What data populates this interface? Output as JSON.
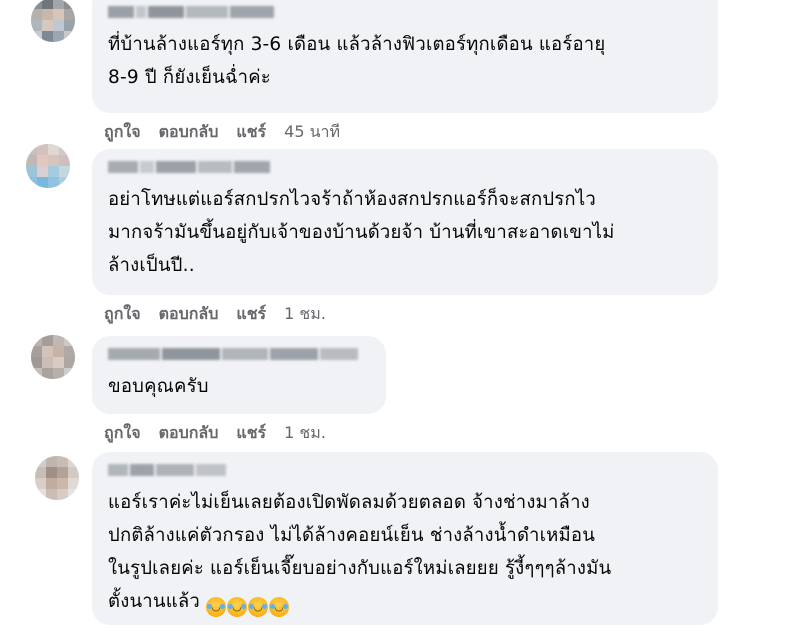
{
  "comments": [
    {
      "text": "ที่บ้านล้างแอร์ทุก 3-6 เดือน แล้วล้างฟิวเตอร์ทุกเดือน แอร์อายุ\n8-9 ปี ก็ยังเย็นฉ่ำค่ะ",
      "like": "ถูกใจ",
      "reply": "ตอบกลับ",
      "share": "แชร์",
      "time": "45 นาที"
    },
    {
      "text": "อย่าโทษแต่แอร์สกปรกไวจร้าถ้าห้องสกปรกแอร์ก็จะสกปรกไว\nมากจร้ามันขึ้นอยู่กับเจ้าของบ้านด้วยจ้า บ้านที่เขาสะอาดเขาไม่\nล้างเป็นปี..",
      "like": "ถูกใจ",
      "reply": "ตอบกลับ",
      "share": "แชร์",
      "time": "1 ชม."
    },
    {
      "text": "ขอบคุณครับ",
      "like": "ถูกใจ",
      "reply": "ตอบกลับ",
      "share": "แชร์",
      "time": "1 ชม."
    },
    {
      "text": "แอร์เราค่ะไม่เย็นเลยต้องเปิดพัดลมด้วยตลอด จ้างช่างมาล้าง\nปกติล้างแค่ตัวกรอง ไม่ได้ล้างคอยน์เย็น ช่างล้างน้ำดำเหมือน\nในรูปเลยค่ะ แอร์เย็นเจี๊ยบอย่างกับแอร์ใหม่เลยยย รู้งี้ๆๆๆล้างมัน\nตั้งนานแล้ว",
      "emoji_icon": "rolling-on-floor-laughing-emoji",
      "emoji_count": 4
    }
  ]
}
